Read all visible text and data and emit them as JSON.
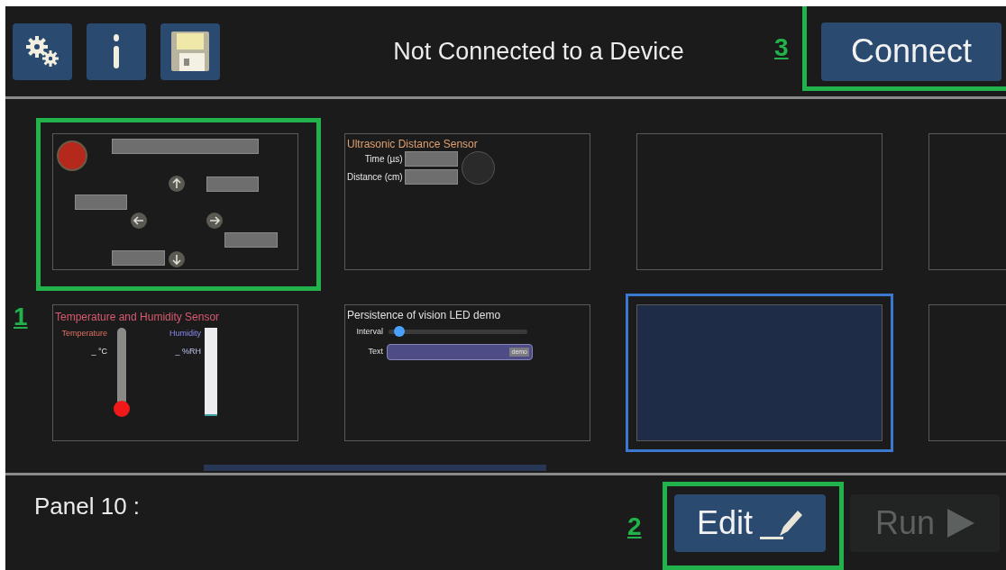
{
  "header": {
    "status": "Not Connected to a Device",
    "connect_button": {
      "label": "Connect",
      "callout": "3"
    }
  },
  "panel_area_callout": "1",
  "panels": [
    {
      "kind": "joystick",
      "selected": false
    },
    {
      "kind": "ultrasonic",
      "selected": false,
      "title": "Ultrasonic Distance Sensor",
      "fields": [
        "Time (µs)",
        "Distance (cm)"
      ]
    },
    {
      "kind": "empty",
      "selected": false
    },
    {
      "kind": "empty",
      "selected": false
    },
    {
      "kind": "thermo",
      "selected": false,
      "title": "Temperature and Humidity Sensor",
      "temperature_label": "Temperature",
      "temperature_reading": "_ °C",
      "humidity_label": "Humidity",
      "humidity_reading": "_ %RH"
    },
    {
      "kind": "pov",
      "selected": false,
      "title": "Persistence of vision LED demo",
      "slider_label": "Interval",
      "level": 0.05,
      "text_label": "Text",
      "text_value": "demo"
    },
    {
      "kind": "empty",
      "selected": true
    },
    {
      "kind": "empty",
      "selected": false
    }
  ],
  "footer": {
    "panel_label": "Panel 10 :",
    "edit_button": {
      "label": "Edit",
      "callout": "2"
    },
    "run_button": {
      "label": "Run",
      "disabled": true
    }
  }
}
